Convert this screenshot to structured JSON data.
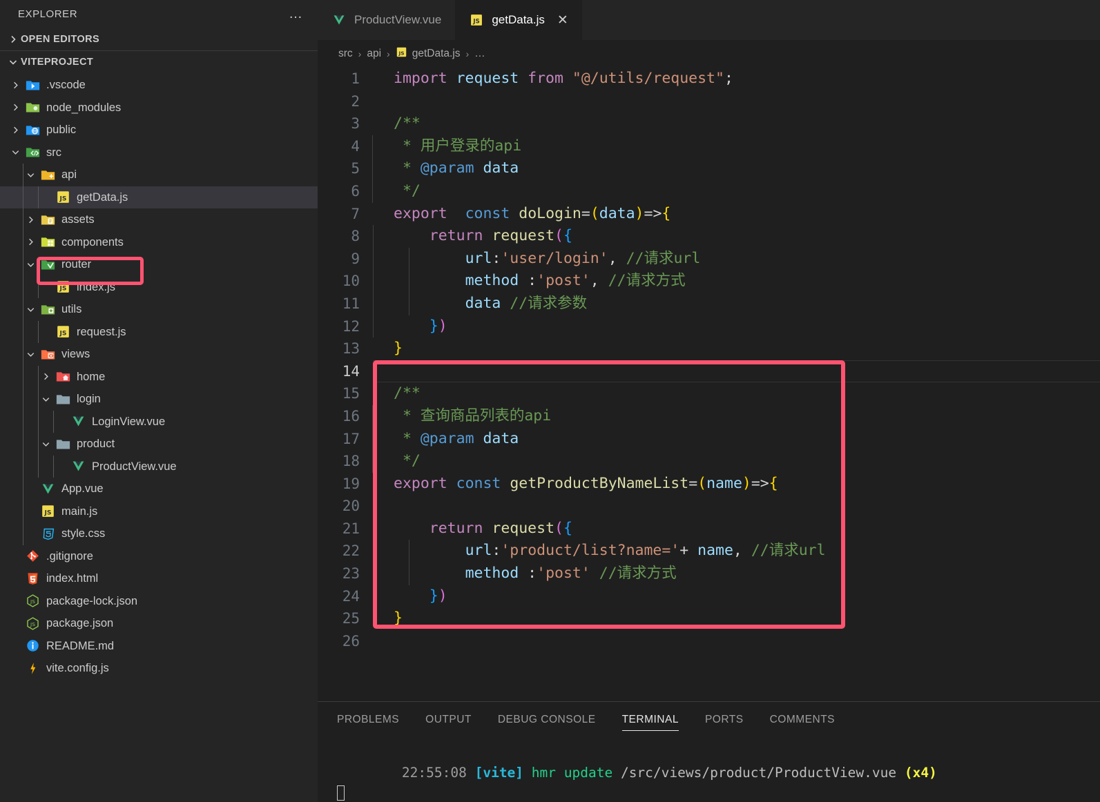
{
  "sidebar": {
    "title": "EXPLORER",
    "more_actions": "…",
    "sections": [
      {
        "label": "OPEN EDITORS",
        "expanded": false
      },
      {
        "label": "VITEPROJECT",
        "expanded": true
      }
    ],
    "tree": [
      {
        "label": ".vscode",
        "icon": "folder-vscode-icon",
        "depth": 1,
        "twisty": "right",
        "type": "folder"
      },
      {
        "label": "node_modules",
        "icon": "folder-node-icon",
        "depth": 1,
        "twisty": "right",
        "type": "folder"
      },
      {
        "label": "public",
        "icon": "folder-public-icon",
        "depth": 1,
        "twisty": "right",
        "type": "folder"
      },
      {
        "label": "src",
        "icon": "folder-src-icon",
        "depth": 1,
        "twisty": "down",
        "type": "folder"
      },
      {
        "label": "api",
        "icon": "folder-api-icon",
        "depth": 2,
        "twisty": "down",
        "type": "folder"
      },
      {
        "label": "getData.js",
        "icon": "js-file-icon",
        "depth": 3,
        "twisty": "none",
        "type": "file",
        "selected": true,
        "highlighted": true
      },
      {
        "label": "assets",
        "icon": "folder-assets-icon",
        "depth": 2,
        "twisty": "right",
        "type": "folder"
      },
      {
        "label": "components",
        "icon": "folder-components-icon",
        "depth": 2,
        "twisty": "right",
        "type": "folder"
      },
      {
        "label": "router",
        "icon": "folder-router-icon",
        "depth": 2,
        "twisty": "down",
        "type": "folder"
      },
      {
        "label": "index.js",
        "icon": "js-file-icon",
        "depth": 3,
        "twisty": "none",
        "type": "file"
      },
      {
        "label": "utils",
        "icon": "folder-utils-icon",
        "depth": 2,
        "twisty": "down",
        "type": "folder"
      },
      {
        "label": "request.js",
        "icon": "js-file-icon",
        "depth": 3,
        "twisty": "none",
        "type": "file"
      },
      {
        "label": "views",
        "icon": "folder-views-icon",
        "depth": 2,
        "twisty": "down",
        "type": "folder"
      },
      {
        "label": "home",
        "icon": "folder-home-icon",
        "depth": 3,
        "twisty": "right",
        "type": "folder"
      },
      {
        "label": "login",
        "icon": "folder-plain-icon",
        "depth": 3,
        "twisty": "down",
        "type": "folder"
      },
      {
        "label": "LoginView.vue",
        "icon": "vue-file-icon",
        "depth": 4,
        "twisty": "none",
        "type": "file"
      },
      {
        "label": "product",
        "icon": "folder-plain-icon",
        "depth": 3,
        "twisty": "down",
        "type": "folder"
      },
      {
        "label": "ProductView.vue",
        "icon": "vue-file-icon",
        "depth": 4,
        "twisty": "none",
        "type": "file"
      },
      {
        "label": "App.vue",
        "icon": "vue-file-icon",
        "depth": 2,
        "twisty": "none",
        "type": "file"
      },
      {
        "label": "main.js",
        "icon": "js-file-icon",
        "depth": 2,
        "twisty": "none",
        "type": "file"
      },
      {
        "label": "style.css",
        "icon": "css-file-icon",
        "depth": 2,
        "twisty": "none",
        "type": "file"
      },
      {
        "label": ".gitignore",
        "icon": "git-file-icon",
        "depth": 1,
        "twisty": "none",
        "type": "file"
      },
      {
        "label": "index.html",
        "icon": "html-file-icon",
        "depth": 1,
        "twisty": "none",
        "type": "file"
      },
      {
        "label": "package-lock.json",
        "icon": "npm-file-icon",
        "depth": 1,
        "twisty": "none",
        "type": "file"
      },
      {
        "label": "package.json",
        "icon": "npm-file-icon",
        "depth": 1,
        "twisty": "none",
        "type": "file"
      },
      {
        "label": "README.md",
        "icon": "info-file-icon",
        "depth": 1,
        "twisty": "none",
        "type": "file"
      },
      {
        "label": "vite.config.js",
        "icon": "vite-file-icon",
        "depth": 1,
        "twisty": "none",
        "type": "file"
      }
    ]
  },
  "tabs": [
    {
      "label": "ProductView.vue",
      "icon": "vue-file-icon",
      "active": false,
      "closable": false
    },
    {
      "label": "getData.js",
      "icon": "js-file-icon",
      "active": true,
      "closable": true,
      "close_label": "✕"
    }
  ],
  "breadcrumb": {
    "items": [
      "src",
      "api",
      "getData.js",
      "…"
    ],
    "separator": "›",
    "file_icon": "js-file-icon"
  },
  "editor": {
    "active_line": 14,
    "total_lines": 26,
    "highlight_color": "#ff5370",
    "lines": [
      {
        "n": 1,
        "tokens": [
          {
            "t": "import ",
            "c": "k-import"
          },
          {
            "t": "request",
            "c": "k-var"
          },
          {
            "t": " from ",
            "c": "k-import"
          },
          {
            "t": "\"@/utils/request\"",
            "c": "k-str"
          },
          {
            "t": ";",
            "c": "k-plain"
          }
        ]
      },
      {
        "n": 2,
        "tokens": []
      },
      {
        "n": 3,
        "tokens": [
          {
            "t": "/**",
            "c": "k-cmt"
          }
        ]
      },
      {
        "n": 4,
        "tokens": [
          {
            "t": " * ",
            "c": "k-cmt"
          },
          {
            "t": "用户登录的api",
            "c": "k-cmt"
          }
        ]
      },
      {
        "n": 5,
        "tokens": [
          {
            "t": " * ",
            "c": "k-cmt"
          },
          {
            "t": "@param",
            "c": "k-jsdoc"
          },
          {
            "t": " ",
            "c": "k-cmt"
          },
          {
            "t": "data",
            "c": "k-var"
          }
        ]
      },
      {
        "n": 6,
        "tokens": [
          {
            "t": " */",
            "c": "k-cmt"
          }
        ]
      },
      {
        "n": 7,
        "tokens": [
          {
            "t": "export",
            "c": "k-import"
          },
          {
            "t": "  ",
            "c": "k-plain"
          },
          {
            "t": "const",
            "c": "k-kw"
          },
          {
            "t": " ",
            "c": "k-plain"
          },
          {
            "t": "doLogin",
            "c": "k-fn"
          },
          {
            "t": "=",
            "c": "k-plain"
          },
          {
            "t": "(",
            "c": "p-y"
          },
          {
            "t": "data",
            "c": "k-var"
          },
          {
            "t": ")",
            "c": "p-y"
          },
          {
            "t": "=>",
            "c": "k-plain"
          },
          {
            "t": "{",
            "c": "p-y"
          }
        ]
      },
      {
        "n": 8,
        "tokens": [
          {
            "t": "    ",
            "c": "k-plain"
          },
          {
            "t": "return",
            "c": "k-import"
          },
          {
            "t": " ",
            "c": "k-plain"
          },
          {
            "t": "request",
            "c": "k-fn"
          },
          {
            "t": "(",
            "c": "p-p"
          },
          {
            "t": "{",
            "c": "p-b"
          }
        ]
      },
      {
        "n": 9,
        "tokens": [
          {
            "t": "        ",
            "c": "k-plain"
          },
          {
            "t": "url",
            "c": "k-var"
          },
          {
            "t": ":",
            "c": "k-plain"
          },
          {
            "t": "'user/login'",
            "c": "k-str"
          },
          {
            "t": ", ",
            "c": "k-plain"
          },
          {
            "t": "//请求url",
            "c": "k-cmt"
          }
        ]
      },
      {
        "n": 10,
        "tokens": [
          {
            "t": "        ",
            "c": "k-plain"
          },
          {
            "t": "method ",
            "c": "k-var"
          },
          {
            "t": ":",
            "c": "k-plain"
          },
          {
            "t": "'post'",
            "c": "k-str"
          },
          {
            "t": ", ",
            "c": "k-plain"
          },
          {
            "t": "//请求方式",
            "c": "k-cmt"
          }
        ]
      },
      {
        "n": 11,
        "tokens": [
          {
            "t": "        ",
            "c": "k-plain"
          },
          {
            "t": "data",
            "c": "k-var"
          },
          {
            "t": " ",
            "c": "k-plain"
          },
          {
            "t": "//请求参数",
            "c": "k-cmt"
          }
        ]
      },
      {
        "n": 12,
        "tokens": [
          {
            "t": "    ",
            "c": "k-plain"
          },
          {
            "t": "}",
            "c": "p-b"
          },
          {
            "t": ")",
            "c": "p-p"
          }
        ]
      },
      {
        "n": 13,
        "tokens": [
          {
            "t": "}",
            "c": "p-y"
          }
        ]
      },
      {
        "n": 14,
        "tokens": []
      },
      {
        "n": 15,
        "tokens": [
          {
            "t": "/**",
            "c": "k-cmt"
          }
        ]
      },
      {
        "n": 16,
        "tokens": [
          {
            "t": " * ",
            "c": "k-cmt"
          },
          {
            "t": "查询商品列表的api",
            "c": "k-cmt"
          }
        ]
      },
      {
        "n": 17,
        "tokens": [
          {
            "t": " * ",
            "c": "k-cmt"
          },
          {
            "t": "@param",
            "c": "k-jsdoc"
          },
          {
            "t": " ",
            "c": "k-cmt"
          },
          {
            "t": "data",
            "c": "k-var"
          }
        ]
      },
      {
        "n": 18,
        "tokens": [
          {
            "t": " */",
            "c": "k-cmt"
          }
        ]
      },
      {
        "n": 19,
        "tokens": [
          {
            "t": "export",
            "c": "k-import"
          },
          {
            "t": " ",
            "c": "k-plain"
          },
          {
            "t": "const",
            "c": "k-kw"
          },
          {
            "t": " ",
            "c": "k-plain"
          },
          {
            "t": "getProductByNameList",
            "c": "k-fn"
          },
          {
            "t": "=",
            "c": "k-plain"
          },
          {
            "t": "(",
            "c": "p-y"
          },
          {
            "t": "name",
            "c": "k-var"
          },
          {
            "t": ")",
            "c": "p-y"
          },
          {
            "t": "=>",
            "c": "k-plain"
          },
          {
            "t": "{",
            "c": "p-y"
          }
        ]
      },
      {
        "n": 20,
        "tokens": []
      },
      {
        "n": 21,
        "tokens": [
          {
            "t": "    ",
            "c": "k-plain"
          },
          {
            "t": "return",
            "c": "k-import"
          },
          {
            "t": " ",
            "c": "k-plain"
          },
          {
            "t": "request",
            "c": "k-fn"
          },
          {
            "t": "(",
            "c": "p-p"
          },
          {
            "t": "{",
            "c": "p-b"
          }
        ]
      },
      {
        "n": 22,
        "tokens": [
          {
            "t": "        ",
            "c": "k-plain"
          },
          {
            "t": "url",
            "c": "k-var"
          },
          {
            "t": ":",
            "c": "k-plain"
          },
          {
            "t": "'product/list?name='",
            "c": "k-str"
          },
          {
            "t": "+ ",
            "c": "k-plain"
          },
          {
            "t": "name",
            "c": "k-var"
          },
          {
            "t": ", ",
            "c": "k-plain"
          },
          {
            "t": "//请求url",
            "c": "k-cmt"
          }
        ]
      },
      {
        "n": 23,
        "tokens": [
          {
            "t": "        ",
            "c": "k-plain"
          },
          {
            "t": "method ",
            "c": "k-var"
          },
          {
            "t": ":",
            "c": "k-plain"
          },
          {
            "t": "'post'",
            "c": "k-str"
          },
          {
            "t": " ",
            "c": "k-plain"
          },
          {
            "t": "//请求方式",
            "c": "k-cmt"
          }
        ]
      },
      {
        "n": 24,
        "tokens": [
          {
            "t": "    ",
            "c": "k-plain"
          },
          {
            "t": "}",
            "c": "p-b"
          },
          {
            "t": ")",
            "c": "p-p"
          }
        ]
      },
      {
        "n": 25,
        "tokens": [
          {
            "t": "}",
            "c": "p-y"
          }
        ]
      },
      {
        "n": 26,
        "tokens": []
      }
    ]
  },
  "panel": {
    "tabs": [
      {
        "label": "PROBLEMS",
        "active": false
      },
      {
        "label": "OUTPUT",
        "active": false
      },
      {
        "label": "DEBUG CONSOLE",
        "active": false
      },
      {
        "label": "TERMINAL",
        "active": true
      },
      {
        "label": "PORTS",
        "active": false
      },
      {
        "label": "COMMENTS",
        "active": false
      }
    ],
    "terminal": {
      "time": "22:55:08",
      "tag": "[vite]",
      "action": "hmr update",
      "path": "/src/views/product/ProductView.vue",
      "count": "(x4)"
    }
  }
}
